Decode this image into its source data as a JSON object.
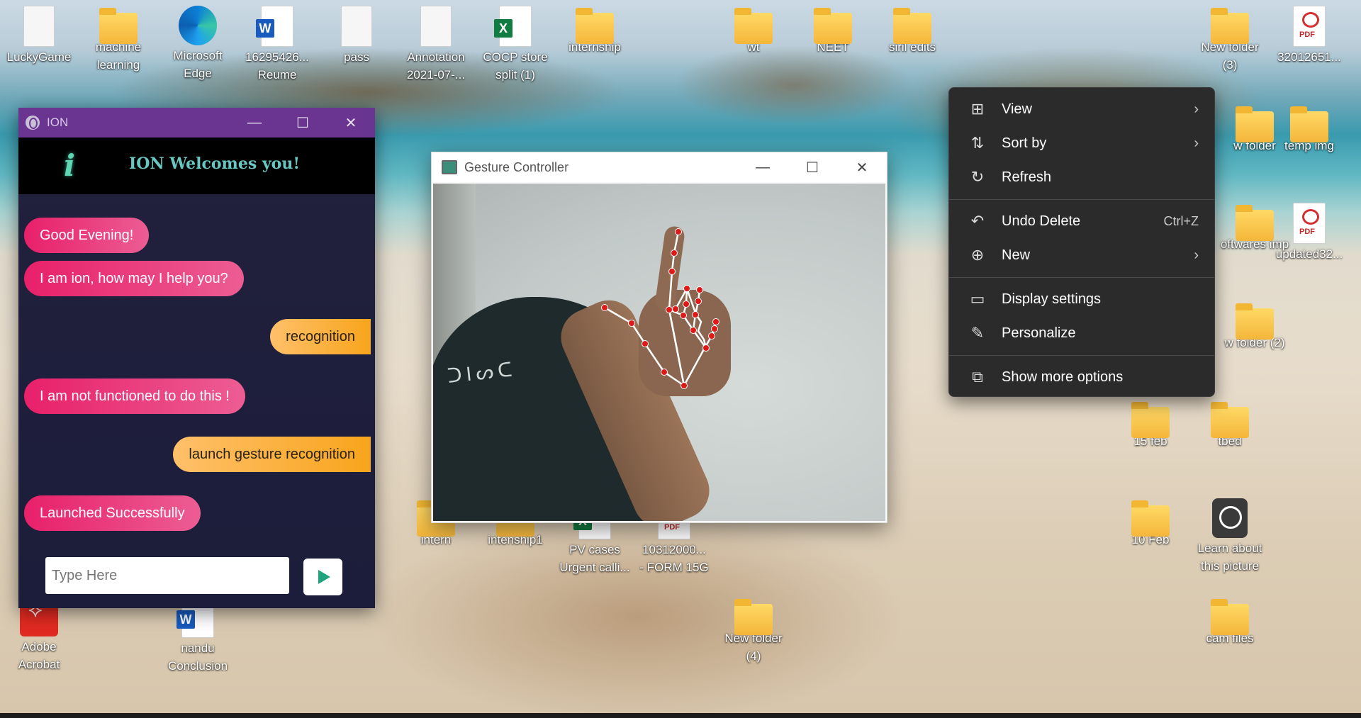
{
  "desktop": {
    "icons": [
      {
        "label": "LuckyGame",
        "type": "doc"
      },
      {
        "label": "machine learning",
        "type": "folder"
      },
      {
        "label": "Microsoft Edge",
        "type": "edge"
      },
      {
        "label": "16295426... Reume",
        "type": "word"
      },
      {
        "label": "pass",
        "type": "doc"
      },
      {
        "label": "Annotation 2021-07-...",
        "type": "doc"
      },
      {
        "label": "COCP store split (1)",
        "type": "excel"
      },
      {
        "label": "internship",
        "type": "folder"
      },
      {
        "label": "wt",
        "type": "folder"
      },
      {
        "label": "NEET",
        "type": "folder"
      },
      {
        "label": "siril edits",
        "type": "folder"
      },
      {
        "label": "New folder (3)",
        "type": "folder"
      },
      {
        "label": "32012651...",
        "type": "pdf"
      },
      {
        "label": "w folder",
        "type": "folder"
      },
      {
        "label": "temp img",
        "type": "folder"
      },
      {
        "label": "oftwares imp",
        "type": "folder"
      },
      {
        "label": "updated32...",
        "type": "pdf"
      },
      {
        "label": "w folder (2)",
        "type": "folder"
      },
      {
        "label": "15 feb",
        "type": "folder"
      },
      {
        "label": "tbed",
        "type": "folder"
      },
      {
        "label": "10 Feb",
        "type": "folder"
      },
      {
        "label": "Learn about this picture",
        "type": "learn"
      },
      {
        "label": "cam files",
        "type": "folder"
      },
      {
        "label": "New folder (4)",
        "type": "folder"
      },
      {
        "label": "intern",
        "type": "folder"
      },
      {
        "label": "intenship1",
        "type": "folder"
      },
      {
        "label": "PV cases Urgent calli...",
        "type": "excel"
      },
      {
        "label": "10312000... - FORM 15G",
        "type": "pdf"
      },
      {
        "label": "Adobe Acrobat",
        "type": "acro"
      },
      {
        "label": "nandu Conclusion",
        "type": "word"
      }
    ]
  },
  "ion_window": {
    "title": "ION",
    "controls": {
      "minimize": "—",
      "maximize": "☐",
      "close": "✕"
    },
    "logo_glyph": "i",
    "welcome": "ION Welcomes you!",
    "messages": [
      {
        "from": "bot",
        "text": "Good Evening!"
      },
      {
        "from": "bot",
        "text": "I am ion, how may I help you?"
      },
      {
        "from": "user",
        "text": "recognition"
      },
      {
        "from": "bot",
        "text": "I am not functioned to do this !"
      },
      {
        "from": "user",
        "text": "launch gesture recognition"
      },
      {
        "from": "bot",
        "text": "Launched Successfully"
      }
    ],
    "input_placeholder": "Type Here"
  },
  "gesture_window": {
    "title": "Gesture Controller",
    "controls": {
      "minimize": "—",
      "maximize": "☐",
      "close": "✕"
    },
    "shirt_text": "ᑐIᔕᑕ"
  },
  "context_menu": {
    "items": [
      {
        "label": "View",
        "icon": "grid-icon",
        "glyph": "⊞",
        "submenu": true
      },
      {
        "label": "Sort by",
        "icon": "sort-icon",
        "glyph": "⇅",
        "submenu": true
      },
      {
        "label": "Refresh",
        "icon": "refresh-icon",
        "glyph": "↻"
      },
      {
        "label": "Undo Delete",
        "icon": "undo-icon",
        "glyph": "↶",
        "shortcut": "Ctrl+Z"
      },
      {
        "label": "New",
        "icon": "plus-circle-icon",
        "glyph": "⊕",
        "submenu": true
      },
      {
        "label": "Display settings",
        "icon": "display-settings-icon",
        "glyph": "▭"
      },
      {
        "label": "Personalize",
        "icon": "brush-icon",
        "glyph": "✎"
      },
      {
        "label": "Show more options",
        "icon": "open-external-icon",
        "glyph": "⧉"
      }
    ],
    "arrow": "›"
  },
  "colors": {
    "ion_titlebar": "#6a3591",
    "bot_bubble": "#e8206a",
    "user_bubble": "#f8a51c",
    "send_icon": "#1fa47e",
    "menu_bg": "#2b2b2b",
    "landmark": "#e01818"
  }
}
